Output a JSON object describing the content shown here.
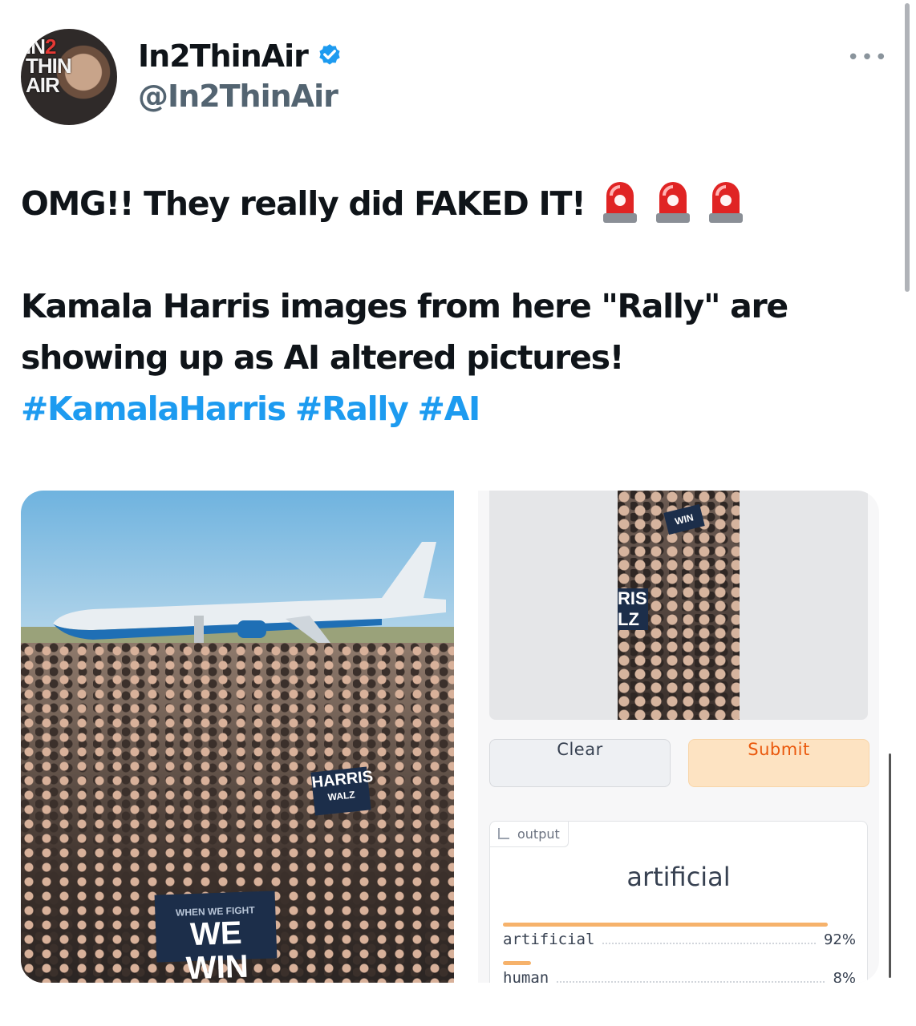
{
  "post": {
    "display_name": "In2ThinAir",
    "handle": "@In2ThinAir",
    "more_label": "•••",
    "avatar_text": "IN2 THIN AIR",
    "text_line1": "OMG!! They really did FAKED IT!",
    "text_line2": "Kamala Harris images from here \"Rally\" are",
    "text_line3": "showing up as AI altered pictures!",
    "hashtags": [
      "#KamalaHarris",
      "#Rally",
      "#AI"
    ]
  },
  "media": {
    "left_photo": {
      "sign1_big": "HARRIS",
      "sign1_small": "WALZ",
      "sign2_small": "WHEN WE FIGHT",
      "sign2_big": "WE WIN"
    },
    "detector": {
      "thumb_sign": "RIS\nLZ",
      "thumb_sign2": "WIN",
      "clear_label": "Clear",
      "submit_label": "Submit",
      "output_tag": "output",
      "result": "artificial",
      "scores": [
        {
          "label": "artificial",
          "value": "92%",
          "fraction": 0.92
        },
        {
          "label": "human",
          "value": "8%",
          "fraction": 0.08
        }
      ]
    }
  },
  "colors": {
    "link": "#1d9bf0",
    "verified": "#1d9bf0",
    "submit_text": "#ea580c",
    "bar": "#f6b26b"
  }
}
